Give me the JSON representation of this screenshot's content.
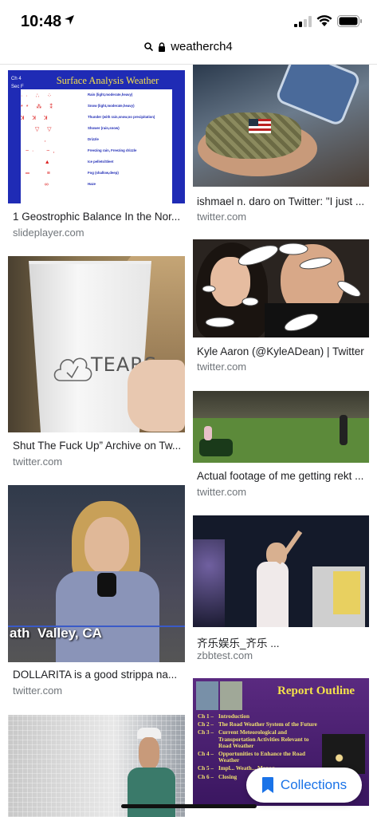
{
  "status_bar": {
    "time": "10:48"
  },
  "url_bar": {
    "url": "weatherch4"
  },
  "results": [
    {
      "title": "1 Geostrophic Balance In the Nor...",
      "source": "slideplayer.com",
      "slide": {
        "header": "Surface Analysis Weather",
        "corner_labels": [
          "Ch 4",
          "Sec F"
        ],
        "rows": [
          "Rain (light,moderate,heavy)",
          "Snow (light,moderate,heavy)",
          "Thunder (with rain,snow,no precipitation)",
          "Shower (rain,snow)",
          "Drizzle",
          "Freezing rain, Freezing drizzle",
          "Ice pellets/Sleet",
          "Fog (shallow,deep)",
          "Haze"
        ]
      }
    },
    {
      "title": "ishmael n. daro on Twitter: \"I just ...",
      "source": "twitter.com"
    },
    {
      "title": "Shut The Fuck Up” Archive on Tw...",
      "source": "twitter.com",
      "cup_text": "TEARS"
    },
    {
      "title": "Kyle Aaron (@KyleADean) | Twitter",
      "source": "twitter.com"
    },
    {
      "title": "Actual footage of me getting rekt ...",
      "source": "twitter.com"
    },
    {
      "title": "DOLLARITA is a good strippa na...",
      "source": "twitter.com",
      "caption": "ath  Valley, CA"
    },
    {
      "title": "齐乐娱乐_齐乐 ...",
      "source": "zbbtest.com"
    },
    {
      "title": "",
      "source": ""
    },
    {
      "title": "",
      "source": "",
      "slide": {
        "header": "Report Outline",
        "rows": [
          {
            "ch": "Ch 1 –",
            "text": "Introduction"
          },
          {
            "ch": "Ch 2 –",
            "text": "The Road Weather System of the Future"
          },
          {
            "ch": "Ch 3 –",
            "text": "Current Meteorological and Transportation Activities Relevant to Road Weather"
          },
          {
            "ch": "Ch 4 –",
            "text": "Opportunities to Enhance the Road Weather"
          },
          {
            "ch": "Ch 5 –",
            "text": "Impl... Weath... Manag..."
          },
          {
            "ch": "Ch 6 –",
            "text": "Closing"
          }
        ]
      }
    }
  ],
  "collections_button": {
    "label": "Collections"
  },
  "colors": {
    "link_blue": "#1a73e8",
    "slide_blue": "#1f2bb5",
    "slide_purple": "#4a1f6b"
  }
}
